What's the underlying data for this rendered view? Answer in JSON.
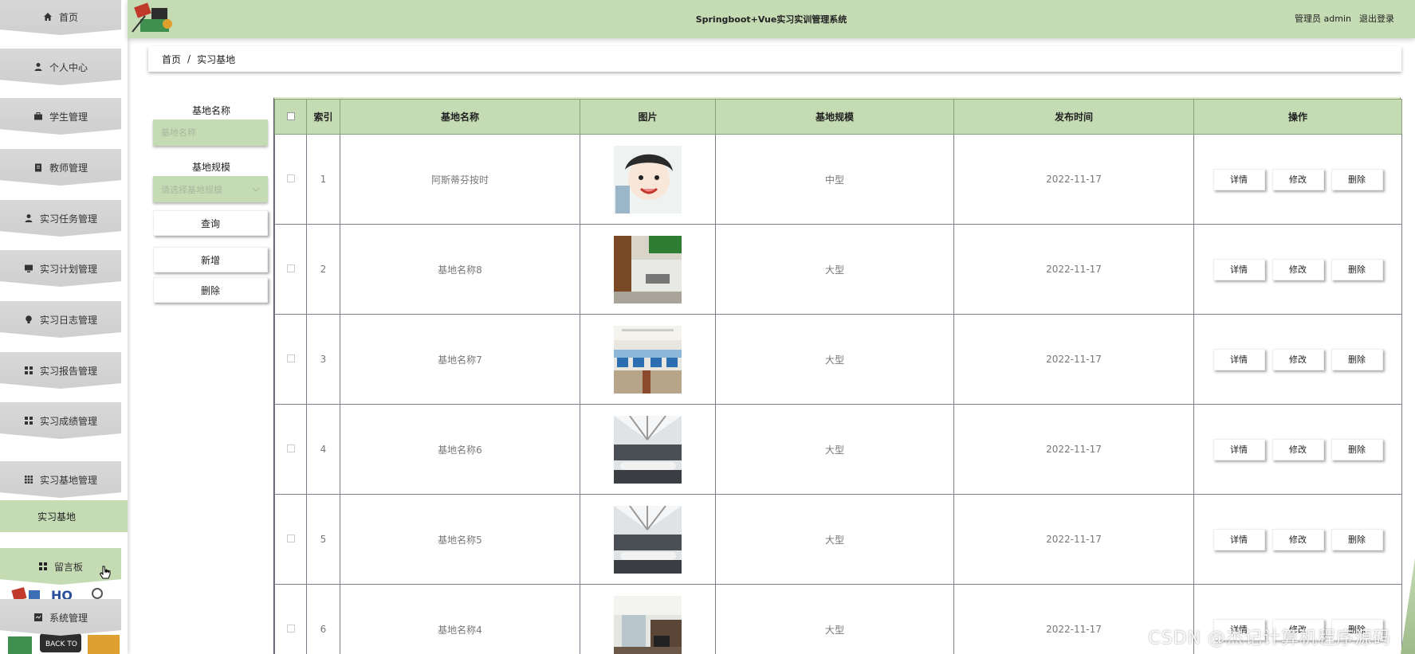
{
  "header": {
    "title": "Springboot+Vue实习实训管理系统",
    "user_label": "管理员 admin",
    "logout": "退出登录"
  },
  "sidebar": {
    "items": [
      {
        "label": "首页",
        "icon": "home-icon"
      },
      {
        "label": "个人中心",
        "icon": "user-icon"
      },
      {
        "label": "学生管理",
        "icon": "briefcase-icon"
      },
      {
        "label": "教师管理",
        "icon": "clipboard-icon"
      },
      {
        "label": "实习任务管理",
        "icon": "user-icon"
      },
      {
        "label": "实习计划管理",
        "icon": "monitor-icon"
      },
      {
        "label": "实习日志管理",
        "icon": "bulb-icon"
      },
      {
        "label": "实习报告管理",
        "icon": "grid-icon"
      },
      {
        "label": "实习成绩管理",
        "icon": "grid-icon"
      },
      {
        "label": "实习基地管理",
        "icon": "apps-icon"
      }
    ],
    "active_sub": "实习基地",
    "message_board": "留言板",
    "system": "系统管理"
  },
  "breadcrumb": {
    "home": "首页",
    "sep": "/",
    "current": "实习基地"
  },
  "search": {
    "name_label": "基地名称",
    "name_placeholder": "基地名称",
    "scale_label": "基地规模",
    "scale_placeholder": "请选择基地规模",
    "query": "查询",
    "add": "新增",
    "delete": "删除"
  },
  "table": {
    "headers": [
      "索引",
      "基地名称",
      "图片",
      "基地规模",
      "发布时间",
      "操作"
    ],
    "rows": [
      {
        "index": "1",
        "name": "阿斯蒂芬按时",
        "scale": "中型",
        "date": "2022-11-17"
      },
      {
        "index": "2",
        "name": "基地名称8",
        "scale": "大型",
        "date": "2022-11-17"
      },
      {
        "index": "3",
        "name": "基地名称7",
        "scale": "大型",
        "date": "2022-11-17"
      },
      {
        "index": "4",
        "name": "基地名称6",
        "scale": "大型",
        "date": "2022-11-17"
      },
      {
        "index": "5",
        "name": "基地名称5",
        "scale": "大型",
        "date": "2022-11-17"
      },
      {
        "index": "6",
        "name": "基地名称4",
        "scale": "大型",
        "date": "2022-11-17"
      }
    ],
    "op_detail": "详情",
    "op_edit": "修改",
    "op_delete": "删除"
  },
  "watermark": "CSDN @杰记计算机程序源码",
  "colors": {
    "accent": "#c5dbb4"
  }
}
